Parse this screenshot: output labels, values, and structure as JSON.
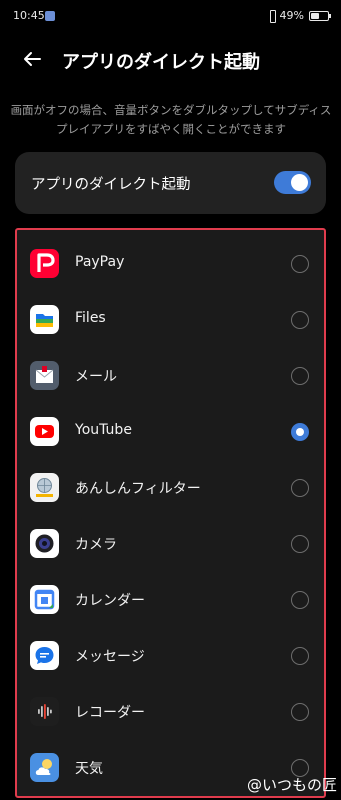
{
  "status_bar": {
    "time": "10:45",
    "battery": "49%",
    "battery_level": 0.49
  },
  "header": {
    "back_icon": "arrow-left-icon",
    "title": "アプリのダイレクト起動"
  },
  "description": "画面がオフの場合、音量ボタンをダブルタップしてサブディスプレイアプリをすばやく開くことができます",
  "toggle": {
    "label": "アプリのダイレクト起動",
    "enabled": true,
    "accent": "#3e7bd8"
  },
  "app_list": {
    "border_color": "#e03c4d",
    "items": [
      {
        "label": "PayPay",
        "icon": "paypay-icon",
        "selected": false
      },
      {
        "label": "Files",
        "icon": "files-icon",
        "selected": false
      },
      {
        "label": "メール",
        "icon": "mail-icon",
        "selected": false
      },
      {
        "label": "YouTube",
        "icon": "youtube-icon",
        "selected": true
      },
      {
        "label": "あんしんフィルター",
        "icon": "filter-icon",
        "selected": false
      },
      {
        "label": "カメラ",
        "icon": "camera-icon",
        "selected": false
      },
      {
        "label": "カレンダー",
        "icon": "calendar-icon",
        "selected": false
      },
      {
        "label": "メッセージ",
        "icon": "messages-icon",
        "selected": false
      },
      {
        "label": "レコーダー",
        "icon": "recorder-icon",
        "selected": false
      },
      {
        "label": "天気",
        "icon": "weather-icon",
        "selected": false
      }
    ]
  },
  "watermark": "@いつもの匠"
}
